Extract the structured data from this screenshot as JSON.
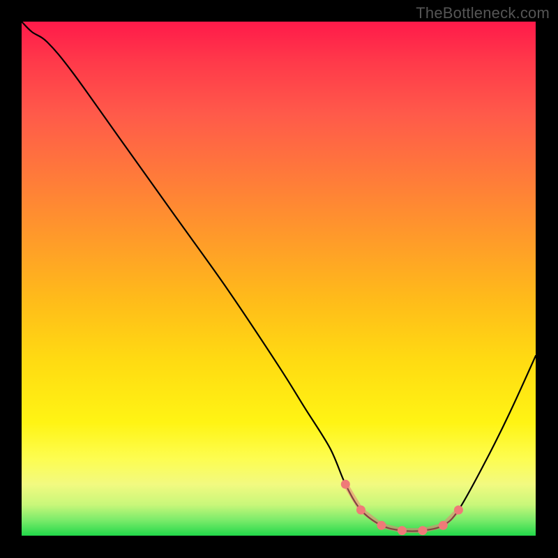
{
  "watermark": "TheBottleneck.com",
  "chart_data": {
    "type": "line",
    "title": "",
    "xlabel": "",
    "ylabel": "",
    "ylim": [
      0,
      1
    ],
    "xlim": [
      0,
      1
    ],
    "x": [
      0.0,
      0.02,
      0.05,
      0.1,
      0.2,
      0.3,
      0.4,
      0.5,
      0.55,
      0.6,
      0.63,
      0.66,
      0.7,
      0.74,
      0.78,
      0.82,
      0.85,
      0.9,
      0.95,
      1.0
    ],
    "values": [
      1.0,
      0.98,
      0.96,
      0.9,
      0.76,
      0.62,
      0.48,
      0.33,
      0.25,
      0.17,
      0.1,
      0.05,
      0.02,
      0.01,
      0.01,
      0.02,
      0.05,
      0.14,
      0.24,
      0.35
    ],
    "flat_zone": {
      "x": [
        0.63,
        0.66,
        0.7,
        0.74,
        0.78,
        0.82,
        0.85
      ],
      "values": [
        0.1,
        0.05,
        0.02,
        0.01,
        0.01,
        0.02,
        0.05
      ]
    },
    "gradient_colors": {
      "top": "#ff1a4a",
      "mid": "#ffdb12",
      "bottom": "#22d84a"
    }
  }
}
